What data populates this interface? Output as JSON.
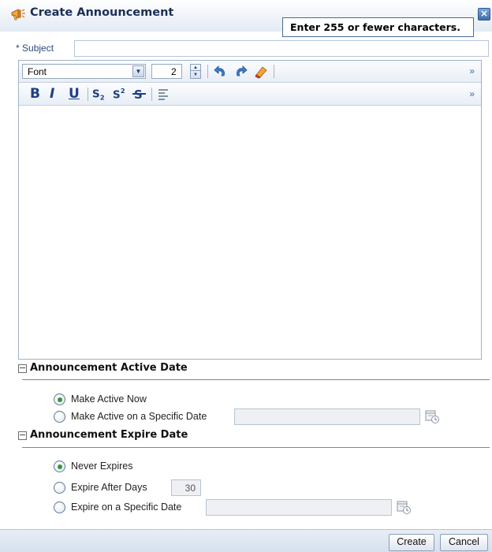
{
  "dialog": {
    "title": "Create Announcement",
    "close_label": "×",
    "tooltip": "Enter 255 or fewer characters."
  },
  "subject": {
    "required_marker": "*",
    "label": "Subject",
    "value": ""
  },
  "editor": {
    "font_select_value": "Font",
    "font_size_value": "2",
    "overflow_glyph": "»",
    "format_buttons": {
      "bold": "B",
      "italic": "I",
      "underline": "U"
    },
    "icons": [
      "undo-icon",
      "redo-icon",
      "eraser-icon",
      "subscript-icon",
      "superscript-icon",
      "strikethrough-icon",
      "align-left-icon"
    ]
  },
  "active_date": {
    "header": "Announcement Active Date",
    "toggle": "−",
    "options": [
      "Make Active Now",
      "Make Active on a Specific Date"
    ],
    "selected": "Make Active Now",
    "date_value": ""
  },
  "expire_date": {
    "header": "Announcement Expire Date",
    "toggle": "−",
    "options": [
      "Never Expires",
      "Expire After Days",
      "Expire on a Specific Date"
    ],
    "selected": "Never Expires",
    "days_value": "30",
    "date_value": ""
  },
  "footer": {
    "create_label": "Create",
    "cancel_label": "Cancel"
  },
  "colors": {
    "accent_title": "#1b2f55",
    "radio_selected": "#2f9a3b",
    "format_blue": "#1d3f86"
  }
}
